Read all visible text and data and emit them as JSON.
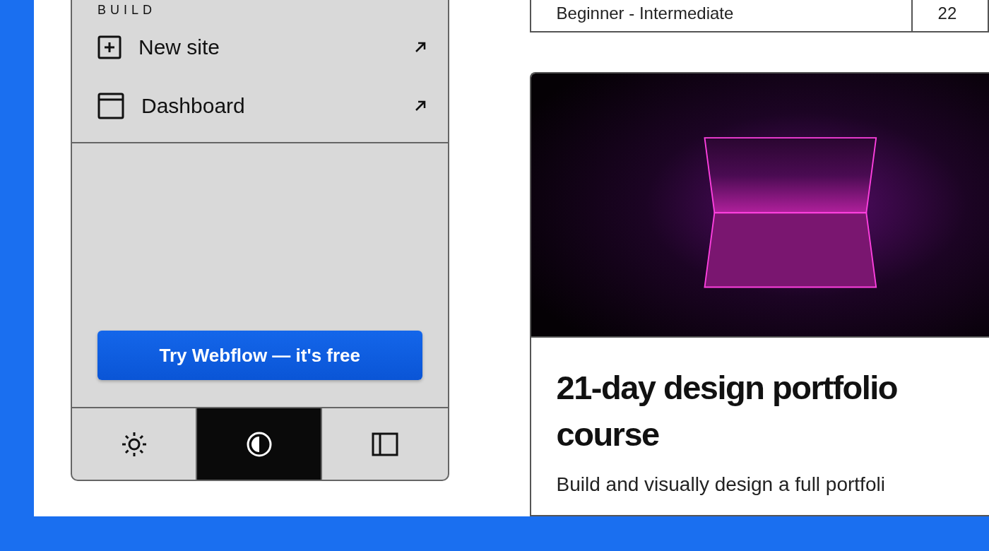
{
  "sidebar": {
    "section_label": "BUILD",
    "items": [
      {
        "kind": "new",
        "label": "New site"
      },
      {
        "kind": "dashboard",
        "label": "Dashboard"
      }
    ],
    "cta": "Try Webflow — it's free",
    "theme_options": [
      {
        "kind": "light",
        "selected": false
      },
      {
        "kind": "contrast",
        "selected": true
      },
      {
        "kind": "layout",
        "selected": false
      }
    ]
  },
  "table": {
    "row": [
      "Beginner - Intermediate",
      "22"
    ]
  },
  "course_card": {
    "title": "21-day design portfolio course",
    "description": "Build and visually design a full portfoli"
  }
}
